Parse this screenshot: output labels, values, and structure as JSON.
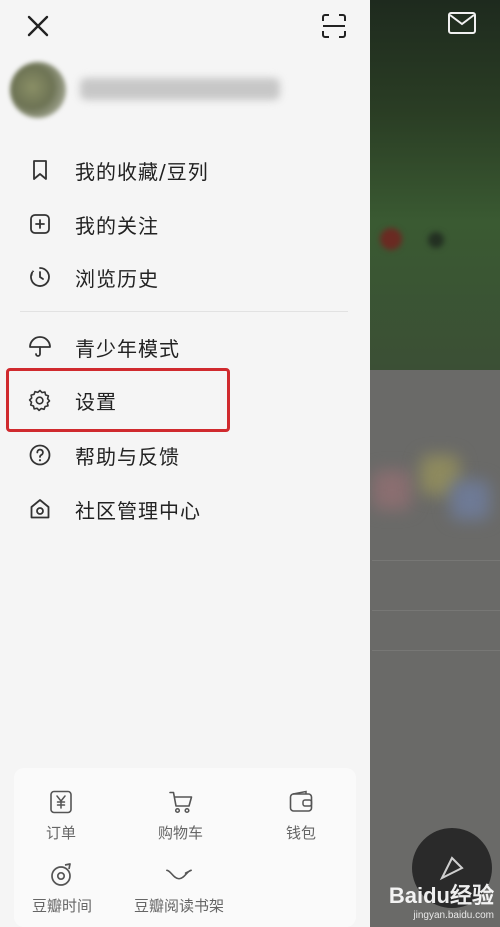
{
  "header": {
    "close_icon": "close-icon",
    "scan_icon": "scan-icon"
  },
  "profile": {
    "username": ""
  },
  "menu": {
    "items": [
      {
        "label": "我的收藏/豆列",
        "icon": "bookmark-icon"
      },
      {
        "label": "我的关注",
        "icon": "add-square-icon"
      },
      {
        "label": "浏览历史",
        "icon": "history-clock-icon"
      },
      {
        "label": "青少年模式",
        "icon": "umbrella-icon"
      },
      {
        "label": "设置",
        "icon": "gear-icon"
      },
      {
        "label": "帮助与反馈",
        "icon": "help-icon"
      },
      {
        "label": "社区管理中心",
        "icon": "home-shield-icon"
      }
    ]
  },
  "bottom_panel": {
    "items": [
      {
        "label": "订单",
        "icon": "order-yen-icon"
      },
      {
        "label": "购物车",
        "icon": "cart-icon"
      },
      {
        "label": "钱包",
        "icon": "wallet-icon"
      },
      {
        "label": "豆瓣时间",
        "icon": "douban-time-icon"
      },
      {
        "label": "豆瓣阅读书架",
        "icon": "douban-read-icon"
      }
    ]
  },
  "watermark": {
    "main": "Baidu经验",
    "sub": "jingyan.baidu.com"
  },
  "colors": {
    "highlight": "#d02a2e",
    "drawer_bg": "#f5f5f5",
    "text": "#222222",
    "icon": "#333333"
  }
}
